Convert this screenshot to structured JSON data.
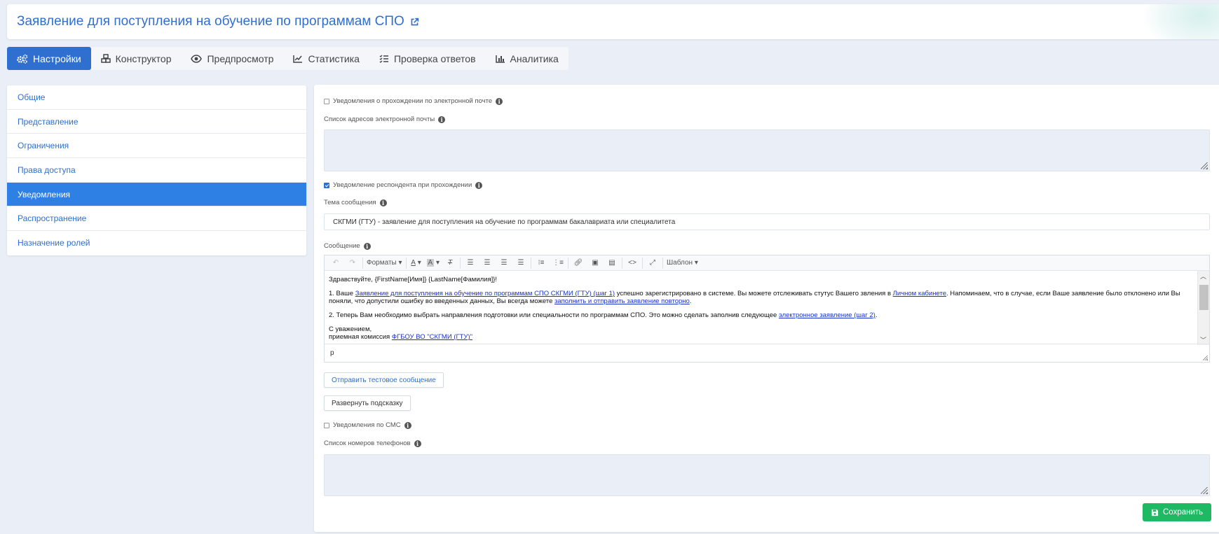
{
  "header": {
    "title": "Заявление для поступления на обучение по программам СПО"
  },
  "tabs": [
    {
      "label": "Настройки",
      "icon": "gears-icon",
      "active": true
    },
    {
      "label": "Конструктор",
      "icon": "cubes-icon"
    },
    {
      "label": "Предпросмотр",
      "icon": "eye-icon"
    },
    {
      "label": "Статистика",
      "icon": "line-chart-icon"
    },
    {
      "label": "Проверка ответов",
      "icon": "tasks-icon"
    },
    {
      "label": "Аналитика",
      "icon": "bar-chart-icon"
    }
  ],
  "sidebar": {
    "items": [
      {
        "label": "Общие"
      },
      {
        "label": "Представление"
      },
      {
        "label": "Ограничения"
      },
      {
        "label": "Права доступа"
      },
      {
        "label": "Уведомления",
        "active": true
      },
      {
        "label": "Распространение"
      },
      {
        "label": "Назначение ролей"
      }
    ]
  },
  "form": {
    "email_notify_label": "Уведомления о прохождении по электронной почте",
    "email_list_label": "Список адресов электронной почты",
    "respondent_notify_label": "Уведомление респондента при прохождении",
    "subject_label": "Тема сообщения",
    "subject_value": "СКГМИ (ГТУ) - заявление для поступления на обучение по программам бакалавриата или специалитета",
    "message_label": "Сообщение",
    "toolbar": {
      "formats": "Форматы",
      "template": "Шаблон"
    },
    "message": {
      "greeting": "Здравствуйте, {FirstName[Имя]} {LastName[Фамилия]}!",
      "p1_a": "1. Ваше ",
      "p1_link1": "Заявление для поступления на обучение по программам СПО СКГМИ (ГТУ) (шаг 1)",
      "p1_b": " успешно зарегистрировано в системе. Вы можете отслеживать стутус Вашего звления в ",
      "p1_link2": "Личном кабинете",
      "p1_c": ". Напоминаем, что в случае, если Ваше заявление было отклонено или Вы поняли, что допустили ошибку во введенных данных, Вы всегда можете ",
      "p1_link3": "заполнить и отправить заявление повторно",
      "p1_d": ".",
      "p2_a": "2. Теперь Вам необходимо выбрать направления подготовки или специальности по программам СПО. Это можно сделать заполнив следующее ",
      "p2_link": "электронное заявление (шаг 2)",
      "p2_b": ".",
      "closing": "С уважением,",
      "sig_a": "приемная комиссия ",
      "sig_link": "ФГБОУ ВО \"СКГМИ (ГТУ)\""
    },
    "status_path": "p",
    "send_test_button": "Отправить тестовое сообщение",
    "expand_hint_button": "Развернуть подсказку",
    "sms_notify_label": "Уведомления по СМС",
    "phones_label": "Список номеров телефонов",
    "save_button": "Сохранить"
  },
  "colors": {
    "accent": "#2f6fd0",
    "save": "#1eb962",
    "active_sidebar": "#2f80e4"
  }
}
